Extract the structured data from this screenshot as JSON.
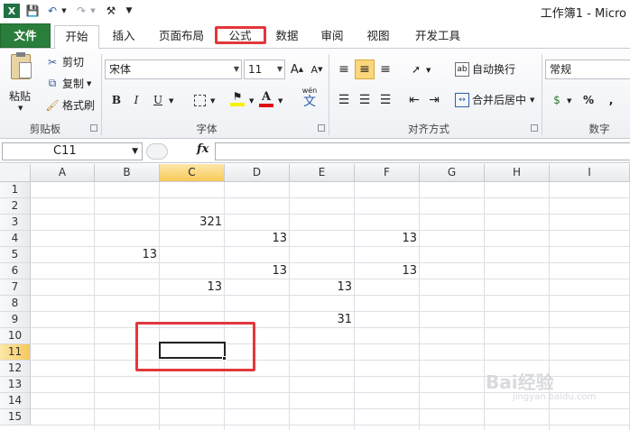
{
  "window": {
    "title": "工作簿1 - Micro"
  },
  "qat": {
    "icons": [
      "excel-logo-icon",
      "save-icon",
      "undo-icon",
      "redo-icon",
      "customize-icon"
    ]
  },
  "tabs": [
    {
      "label": "文件",
      "name": "tab-file"
    },
    {
      "label": "开始",
      "name": "tab-home"
    },
    {
      "label": "插入",
      "name": "tab-insert"
    },
    {
      "label": "页面布局",
      "name": "tab-page-layout"
    },
    {
      "label": "公式",
      "name": "tab-formulas"
    },
    {
      "label": "数据",
      "name": "tab-data"
    },
    {
      "label": "审阅",
      "name": "tab-review"
    },
    {
      "label": "视图",
      "name": "tab-view"
    },
    {
      "label": "开发工具",
      "name": "tab-developer"
    }
  ],
  "ribbon": {
    "clipboard": {
      "paste": "粘贴",
      "cut": "剪切",
      "copy": "复制",
      "format_painter": "格式刷",
      "group_label": "剪贴板"
    },
    "font": {
      "font_name": "宋体",
      "font_size": "11",
      "bold": "B",
      "italic": "I",
      "underline": "U",
      "wen": "wén",
      "wen_char": "文",
      "group_label": "字体"
    },
    "alignment": {
      "wrap_text": "自动换行",
      "merge_center": "合并后居中",
      "group_label": "对齐方式"
    },
    "number": {
      "format": "常规",
      "percent": "%",
      "comma": ",",
      "group_label": "数字"
    }
  },
  "formula_bar": {
    "name_box": "C11",
    "fx_label": "fx",
    "formula": ""
  },
  "sheet": {
    "columns": [
      "A",
      "B",
      "C",
      "D",
      "E",
      "F",
      "G",
      "H",
      "I"
    ],
    "rows": [
      "1",
      "2",
      "3",
      "4",
      "5",
      "6",
      "7",
      "8",
      "9",
      "10",
      "11",
      "12",
      "13",
      "14",
      "15"
    ],
    "active_column": "C",
    "active_row": "11",
    "cells": [
      {
        "ref": "C3",
        "value": "321"
      },
      {
        "ref": "D4",
        "value": "13"
      },
      {
        "ref": "F4",
        "value": "13"
      },
      {
        "ref": "B5",
        "value": "13"
      },
      {
        "ref": "D6",
        "value": "13"
      },
      {
        "ref": "F6",
        "value": "13"
      },
      {
        "ref": "C7",
        "value": "13"
      },
      {
        "ref": "E7",
        "value": "13"
      },
      {
        "ref": "E9",
        "value": "31"
      }
    ]
  },
  "watermark": {
    "text": "Bai经验",
    "sub": "jingyan.baidu.com"
  },
  "colors": {
    "file_tab": "#2a7e3b",
    "highlight": "#e2373c",
    "active_header": "#f7c95a"
  }
}
